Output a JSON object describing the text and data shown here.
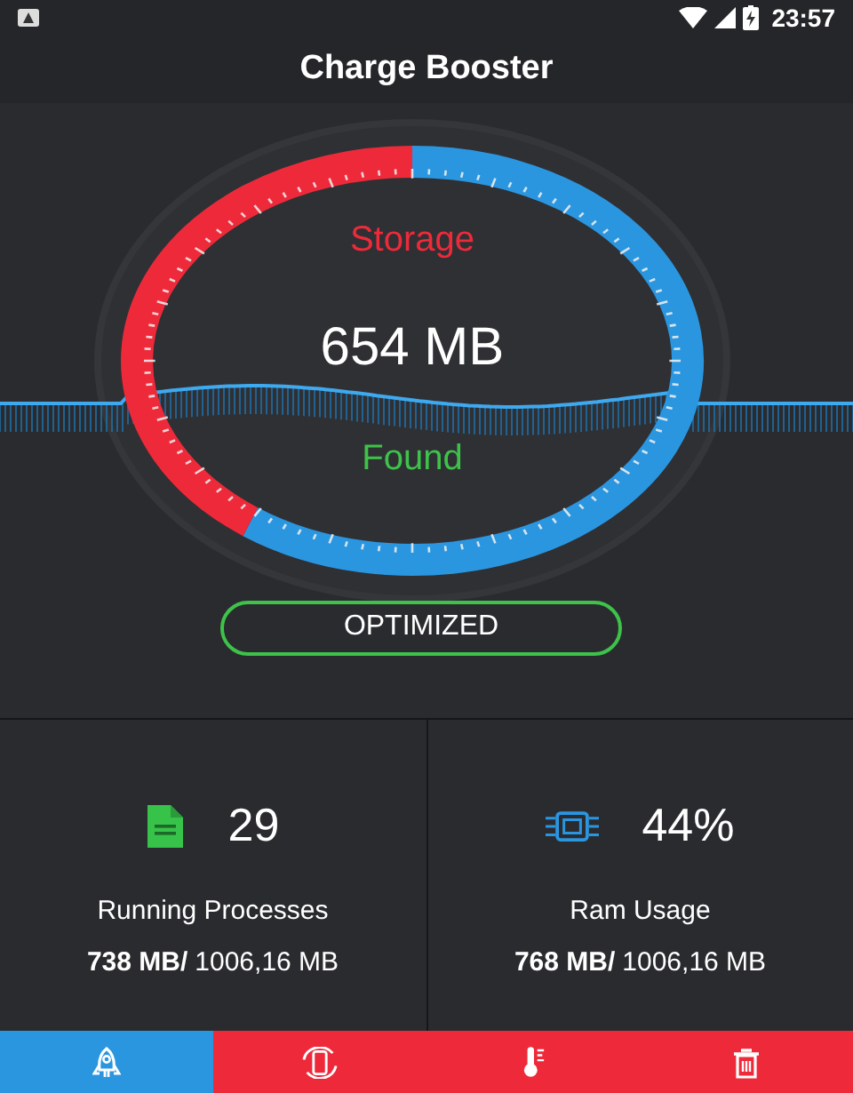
{
  "status_bar": {
    "time": "23:57"
  },
  "app_bar": {
    "title": "Charge Booster"
  },
  "gauge": {
    "label": "Storage",
    "value": "654 MB",
    "caption": "Found"
  },
  "status_button": {
    "label": "OPTIMIZED"
  },
  "stats": [
    {
      "kind": "processes",
      "value": "29",
      "label": "Running Processes",
      "used": "738 MB/",
      "total": "1006,16 MB"
    },
    {
      "kind": "ram",
      "value": "44%",
      "label": "Ram Usage",
      "used": "768 MB/",
      "total": "1006,16 MB"
    }
  ],
  "nav": [
    {
      "kind": "boost",
      "selected": true
    },
    {
      "kind": "battery",
      "selected": false
    },
    {
      "kind": "temperature",
      "selected": false
    },
    {
      "kind": "trash",
      "selected": false
    }
  ]
}
